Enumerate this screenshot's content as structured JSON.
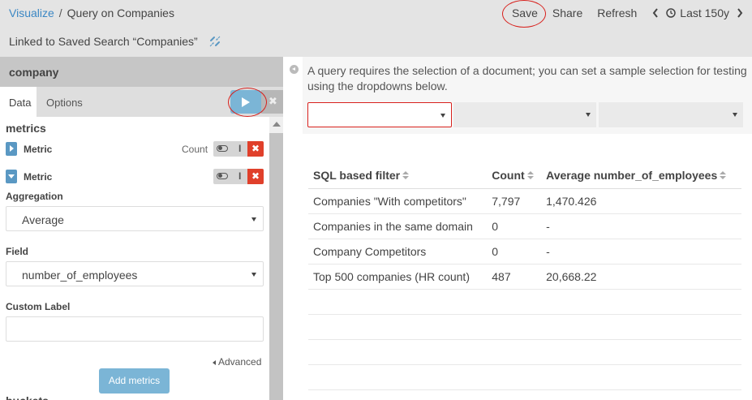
{
  "breadcrumb": {
    "root": "Visualize",
    "separator": "/",
    "current": "Query on Companies"
  },
  "linked_search": {
    "text": "Linked to Saved Search “Companies”",
    "icon": "unlink-icon"
  },
  "topnav": {
    "save": "Save",
    "share": "Share",
    "refresh": "Refresh",
    "time_label": "Last 150y"
  },
  "sidebar": {
    "index_name": "company",
    "tabs": {
      "data": "Data",
      "options": "Options"
    },
    "discard_glyph": "✖",
    "section_title": "metrics",
    "metrics": [
      {
        "label": "Metric",
        "summary": "Count",
        "collapsed": true
      },
      {
        "label": "Metric",
        "summary": "",
        "collapsed": false
      }
    ],
    "aggregation": {
      "label": "Aggregation",
      "value": "Average"
    },
    "field": {
      "label": "Field",
      "value": "number_of_employees"
    },
    "custom_label": {
      "label": "Custom Label",
      "value": ""
    },
    "advanced": "Advanced",
    "add_metrics": "Add metrics",
    "next_section": "buckets"
  },
  "info": {
    "text": "A query requires the selection of a document; you can set a sample selection for testing using the dropdowns below."
  },
  "results": {
    "columns": [
      "SQL based filter",
      "Count",
      "Average number_of_employees"
    ],
    "rows": [
      [
        "Companies \"With competitors\"",
        "7,797",
        "1,470.426"
      ],
      [
        "Companies in the same domain",
        "0",
        "-"
      ],
      [
        "Company Competitors",
        "0",
        "-"
      ],
      [
        "Top 500 companies (HR count)",
        "487",
        "20,668.22"
      ]
    ]
  },
  "colors": {
    "accent": "#3b87c4",
    "button": "#7bb5d6",
    "delete": "#e0402b",
    "highlight_ring": "#d8211d"
  }
}
